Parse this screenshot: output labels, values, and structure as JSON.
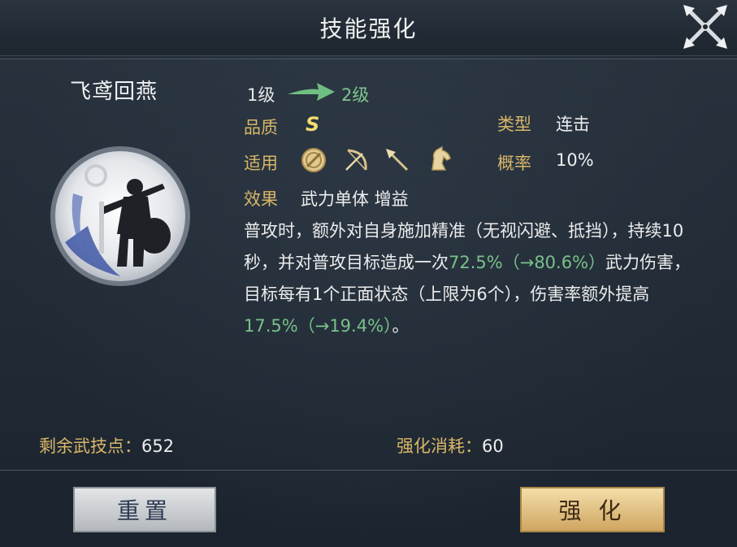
{
  "window": {
    "title": "技能强化"
  },
  "skill": {
    "name": "飞鸢回燕",
    "level_from": "1级",
    "level_to": "2级",
    "quality_label": "品质",
    "quality_value": "S",
    "type_label": "类型",
    "type_value": "连击",
    "applies_label": "适用",
    "applies_icons": [
      "shield-icon",
      "bow-icon",
      "spear-icon",
      "horse-icon"
    ],
    "chance_label": "概率",
    "chance_value": "10%",
    "effect_label": "效果",
    "effect_value": "武力单体 增益",
    "description": {
      "p1": "普攻时，额外对自身施加精准（无视闪避、抵挡），持续10秒，并对普攻目标造成一次",
      "v1": "72.5%",
      "v1_up": "（→80.6%）",
      "p2": "武力伤害，目标每有1个正面状态（上限为6个），伤害率额外提高",
      "v2": "17.5%",
      "v2_up": "（→19.4%）",
      "p3": "。"
    }
  },
  "footer": {
    "points_label": "剩余武技点：",
    "points_value": "652",
    "cost_label": "强化消耗：",
    "cost_value": "60"
  },
  "buttons": {
    "reset": "重置",
    "upgrade": "强 化"
  },
  "colors": {
    "accent_gold": "#d8b668",
    "upgrade_green": "#79c18a",
    "grade_yellow": "#f3dc71"
  }
}
